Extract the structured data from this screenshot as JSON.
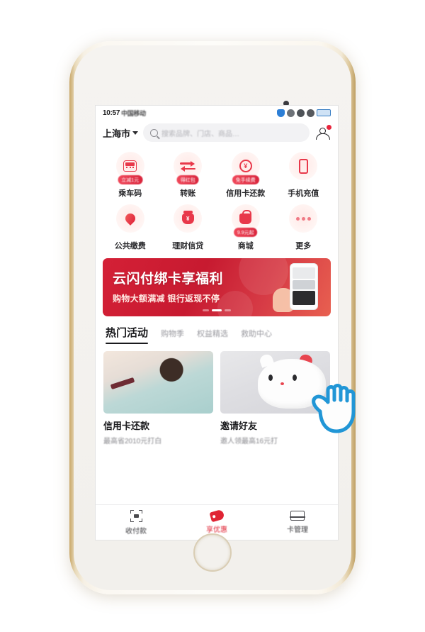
{
  "status_bar": {
    "time": "10:57",
    "carrier": "中国移动",
    "icons": [
      "shield-icon",
      "cloud-icon",
      "eye-icon",
      "alarm-icon",
      "battery-icon"
    ]
  },
  "header": {
    "city": "上海市",
    "city_caret": "chevron-down-icon",
    "search_placeholder": "搜索品牌、门店、商品…",
    "search_icon": "search-icon",
    "avatar_icon": "user-avatar-icon",
    "avatar_badge": "1"
  },
  "quick_actions": [
    {
      "label": "乘车码",
      "badge": "立减1元",
      "icon": "bus-icon"
    },
    {
      "label": "转账",
      "badge": "得红包",
      "icon": "transfer-arrows-icon"
    },
    {
      "label": "信用卡还款",
      "badge": "免手续费",
      "icon": "credit-card-repay-icon"
    },
    {
      "label": "手机充值",
      "badge": "",
      "icon": "mobile-phone-icon"
    },
    {
      "label": "公共缴费",
      "badge": "",
      "icon": "water-drop-icon"
    },
    {
      "label": "理财信贷",
      "badge": "",
      "icon": "money-purse-icon"
    },
    {
      "label": "商城",
      "badge": "9.9元起",
      "icon": "shopping-bag-icon"
    },
    {
      "label": "更多",
      "badge": "",
      "icon": "more-dots-icon"
    }
  ],
  "banner": {
    "title": "云闪付绑卡享福利",
    "subtitle": "购物大额满减 银行返现不停",
    "phone_icon": "phone-mockup-icon",
    "hand_icon": "hand-holding-icon",
    "dot_count": 3,
    "active_dot": 2,
    "bg_color": "#c71a30"
  },
  "tabs": {
    "active": "热门活动",
    "items": [
      "热门活动",
      "购物季",
      "权益精选",
      "救助中心"
    ]
  },
  "cards": [
    {
      "title": "信用卡还款",
      "subtitle": "最高省2010元打白",
      "image": "man-holding-card-photo"
    },
    {
      "title": "邀请好友",
      "subtitle": "邀人领最高16元打",
      "image": "lucky-cat-photo"
    }
  ],
  "bottom_nav": {
    "active": "享优惠",
    "items": [
      {
        "label": "收付款",
        "icon": "scan-pay-icon"
      },
      {
        "label": "享优惠",
        "icon": "coupon-tag-icon"
      },
      {
        "label": "卡管理",
        "icon": "bank-cards-icon"
      }
    ],
    "active_color": "#e02434"
  },
  "overlay": {
    "cursor_icon": "pointing-hand-cursor",
    "cursor_color": "#2196d6"
  },
  "device": {
    "body_color": "#f7f3ec",
    "frame_accent": "#c9a86a",
    "home_button": "home-button"
  }
}
